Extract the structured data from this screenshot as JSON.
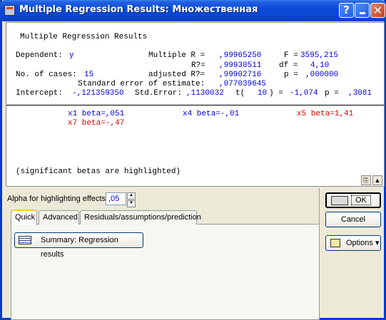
{
  "window": {
    "title": "Multiple Regression Results: Множественная",
    "controls": {
      "help": "?",
      "minimize": "_",
      "close": "✕"
    }
  },
  "report": {
    "heading": "Multiple Regression Results",
    "dependent_label": "Dependent:",
    "dependent_value": "y",
    "multiple_r_label": "Multiple R =",
    "multiple_r_value": ",99965250",
    "f_label": "F =",
    "f_value": "3595,215",
    "r2_label": "R?=",
    "r2_value": ",99930511",
    "df_label": "df =",
    "df_value": "4,10",
    "cases_label": "No. of cases:",
    "cases_value": "15",
    "adj_r2_label": "adjusted R?=",
    "adj_r2_value": ",99902716",
    "p_label": "p =",
    "p_value": ",000000",
    "std_err_est_label": "Standard error of estimate:",
    "std_err_est_value": ",077039645",
    "intercept_label": "Intercept:",
    "intercept_value": "-,121359350",
    "std_error_label": "Std.Error:",
    "std_error_value": ",1130032",
    "t_label": "t(",
    "t_df": "10",
    "t_eq": ") =",
    "t_value": "-1,074",
    "p2_label": "p =",
    "p2_value": ",3081",
    "betas": [
      {
        "text": "x1 beta=,051",
        "significant": false
      },
      {
        "text": "x4 beta=-,01",
        "significant": false
      },
      {
        "text": "x5 beta=1,41",
        "significant": true
      },
      {
        "text": "x7 beta=-,47",
        "significant": true
      }
    ],
    "footnote": "(significant betas are highlighted)"
  },
  "alpha": {
    "label": "Alpha for highlighting effects:",
    "value": ",05"
  },
  "buttons": {
    "ok": "OK",
    "cancel": "Cancel",
    "options": "Options ▾"
  },
  "tabs": [
    {
      "label": "Quick",
      "active": true
    },
    {
      "label": "Advanced",
      "active": false
    },
    {
      "label": "Residuals/assumptions/prediction",
      "active": false
    }
  ],
  "quick": {
    "summary_button": "Summary:  Regression results"
  },
  "colors": {
    "value_blue": "#0000e0",
    "significant_red": "#e00000",
    "titlebar_blue": "#0a48d4"
  }
}
